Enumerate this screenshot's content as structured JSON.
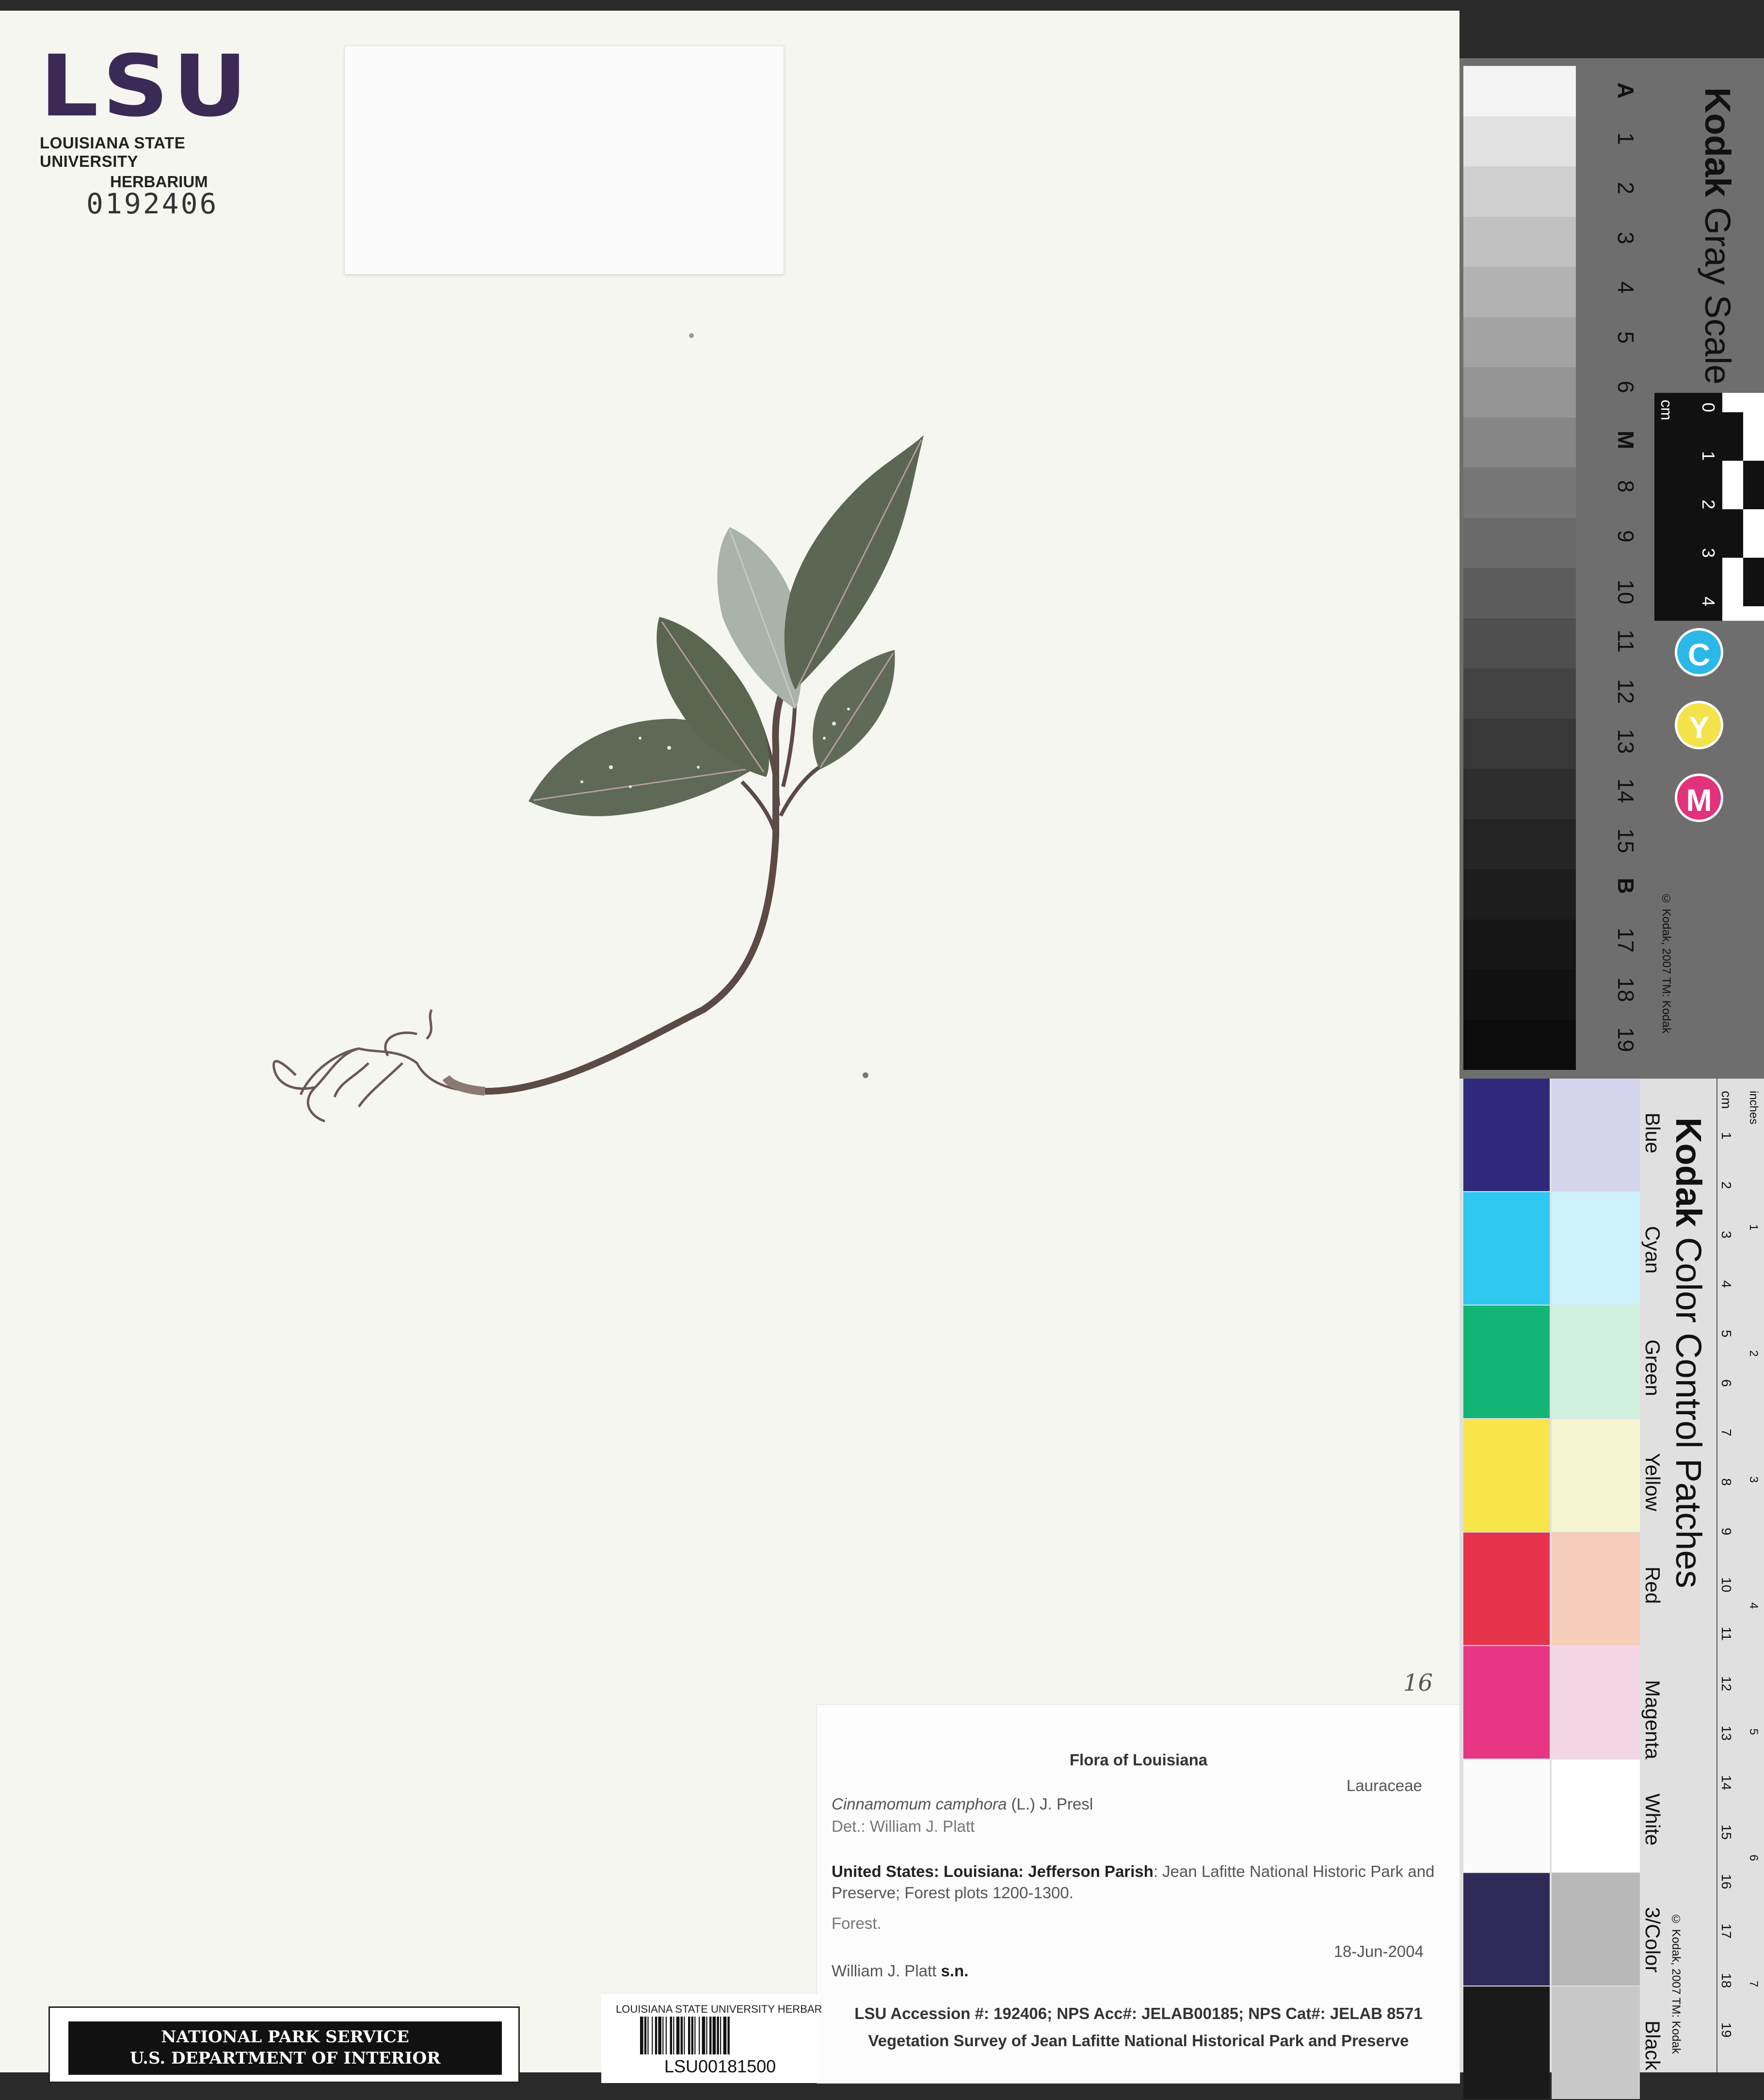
{
  "header": {
    "logo_text": "LSU",
    "institution_line1": "LOUISIANA STATE UNIVERSITY",
    "institution_line2": "HERBARIUM",
    "accession_number": "0192406"
  },
  "pencil_note": "16",
  "specimen_label": {
    "title": "Flora of Louisiana",
    "family": "Lauraceae",
    "scientific_name": "Cinnamomum camphora",
    "author": "(L.) J. Presl",
    "determiner": "Det.: William J. Platt",
    "locality_bold": "United States: Louisiana: Jefferson Parish",
    "locality_text": ": Jean Lafitte National Historic Park and Preserve; Forest plots 1200-1300.",
    "habitat": "Forest.",
    "date": "18-Jun-2004",
    "collector": "William J. Platt",
    "collector_number": "s.n.",
    "accession_line": "LSU Accession #: 192406; NPS Acc#: JELAB00185; NPS Cat#: JELAB  8571",
    "project": "Vegetation Survey of Jean Lafitte National Historical Park and Preserve"
  },
  "nps_stamp": {
    "line1": "NATIONAL PARK SERVICE",
    "line2": "U.S. DEPARTMENT OF INTERIOR"
  },
  "barcode": {
    "header": "LOUISIANA STATE UNIVERSITY HERBAR",
    "number": "LSU00181500"
  },
  "gray_scale_card": {
    "brand": "Kodak",
    "title": "Gray Scale",
    "steps": [
      "A",
      "1",
      "2",
      "3",
      "4",
      "5",
      "6",
      "M",
      "8",
      "9",
      "10",
      "11",
      "12",
      "13",
      "14",
      "15",
      "B",
      "17",
      "18",
      "19"
    ],
    "ruler_unit": "cm",
    "ruler_numbers": [
      "0",
      "1",
      "2",
      "3",
      "4"
    ],
    "cmy_dots": [
      "C",
      "Y",
      "M"
    ],
    "copyright": "© Kodak, 2007  TM: Kodak"
  },
  "color_control_card": {
    "brand": "Kodak",
    "title": "Color Control Patches",
    "patch_names": [
      "Blue",
      "Cyan",
      "Green",
      "Yellow",
      "Red",
      "Magenta",
      "White",
      "3/Color",
      "Black"
    ],
    "ruler_units": [
      "cm",
      "inches"
    ],
    "cm_numbers": [
      "1",
      "2",
      "3",
      "4",
      "5",
      "6",
      "7",
      "8",
      "9",
      "10",
      "11",
      "12",
      "13",
      "14",
      "15",
      "16",
      "17",
      "18",
      "19"
    ],
    "inch_numbers": [
      "1",
      "2",
      "3",
      "4",
      "5",
      "6",
      "7"
    ],
    "copyright": "© Kodak, 2007  TM: Kodak"
  },
  "colors": {
    "sheet": "#f6f6f1",
    "lsu_purple": "#3b2a55",
    "leaf_dark": "#5a6650",
    "leaf_pale": "#a9b3a9",
    "stem": "#5c4a45"
  }
}
